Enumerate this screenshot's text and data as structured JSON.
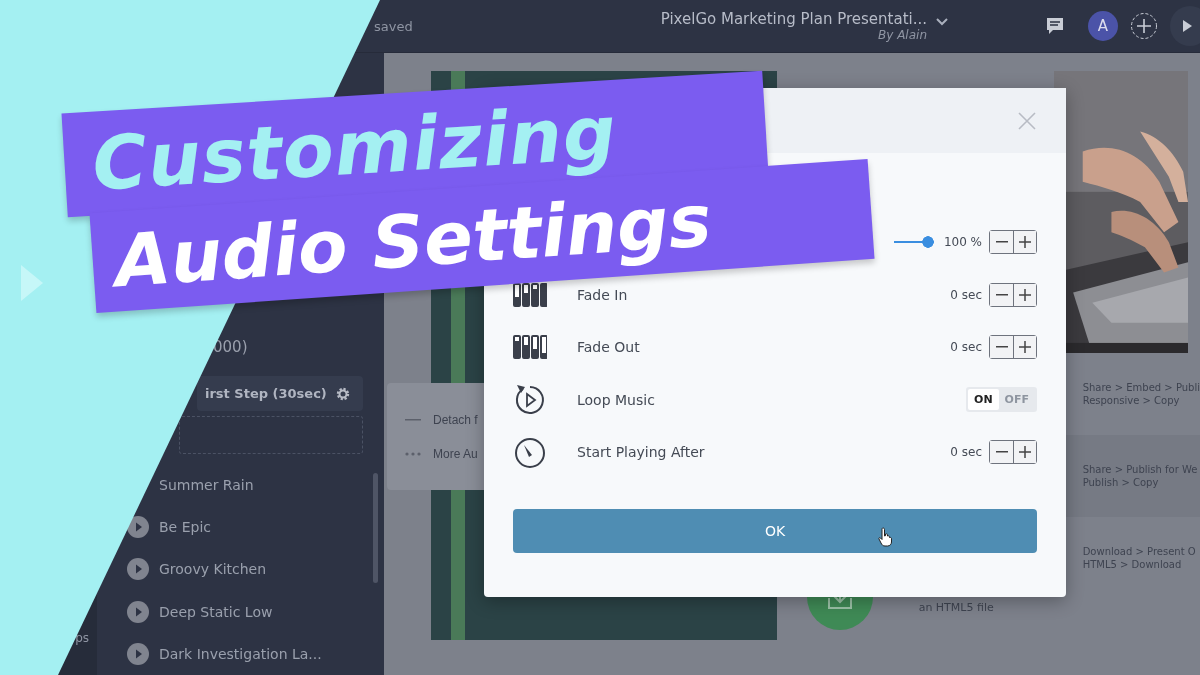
{
  "topbar": {
    "save_status": "saved",
    "title": "PixelGo Marketing Plan Presentati...",
    "author": "By Alain",
    "avatar": "A"
  },
  "sidebar": {
    "rail_label": "ps",
    "count": "000)",
    "step": "irst Step (30sec)",
    "tracks": [
      {
        "name": "Summer Rain"
      },
      {
        "name": "Be Epic"
      },
      {
        "name": "Groovy Kitchen"
      },
      {
        "name": "Deep Static Low"
      },
      {
        "name": "Dark Investigation La..."
      }
    ]
  },
  "context_menu": [
    {
      "kind": "line",
      "label": "Detach f"
    },
    {
      "kind": "dots",
      "label": "More Au"
    }
  ],
  "canvas": {
    "file_note": "an HTML5 file",
    "instructions": [
      {
        "lines": [
          "Share > Embed > Publi",
          "Responsive > Copy"
        ]
      },
      {
        "lines": [
          "Share > Publish for We",
          "Publish > Copy"
        ]
      },
      {
        "lines": [
          "Download > Present O",
          "HTML5 > Download"
        ]
      }
    ]
  },
  "dialog": {
    "rows": [
      {
        "kind": "slider",
        "level": 1,
        "reading": "100 %"
      },
      {
        "kind": "stepper",
        "label": "Fade In",
        "reading": "0 sec"
      },
      {
        "kind": "stepper",
        "label": "Fade Out",
        "reading": "0 sec"
      },
      {
        "kind": "toggle",
        "label": "Loop Music",
        "on": true,
        "on_label": "ON",
        "off_label": "OFF"
      },
      {
        "kind": "stepper",
        "label": "Start Playing After",
        "reading": "0 sec"
      }
    ],
    "ok": "OK"
  },
  "banner": {
    "line_1": "Customizing",
    "line_2": "Audio Settings"
  }
}
